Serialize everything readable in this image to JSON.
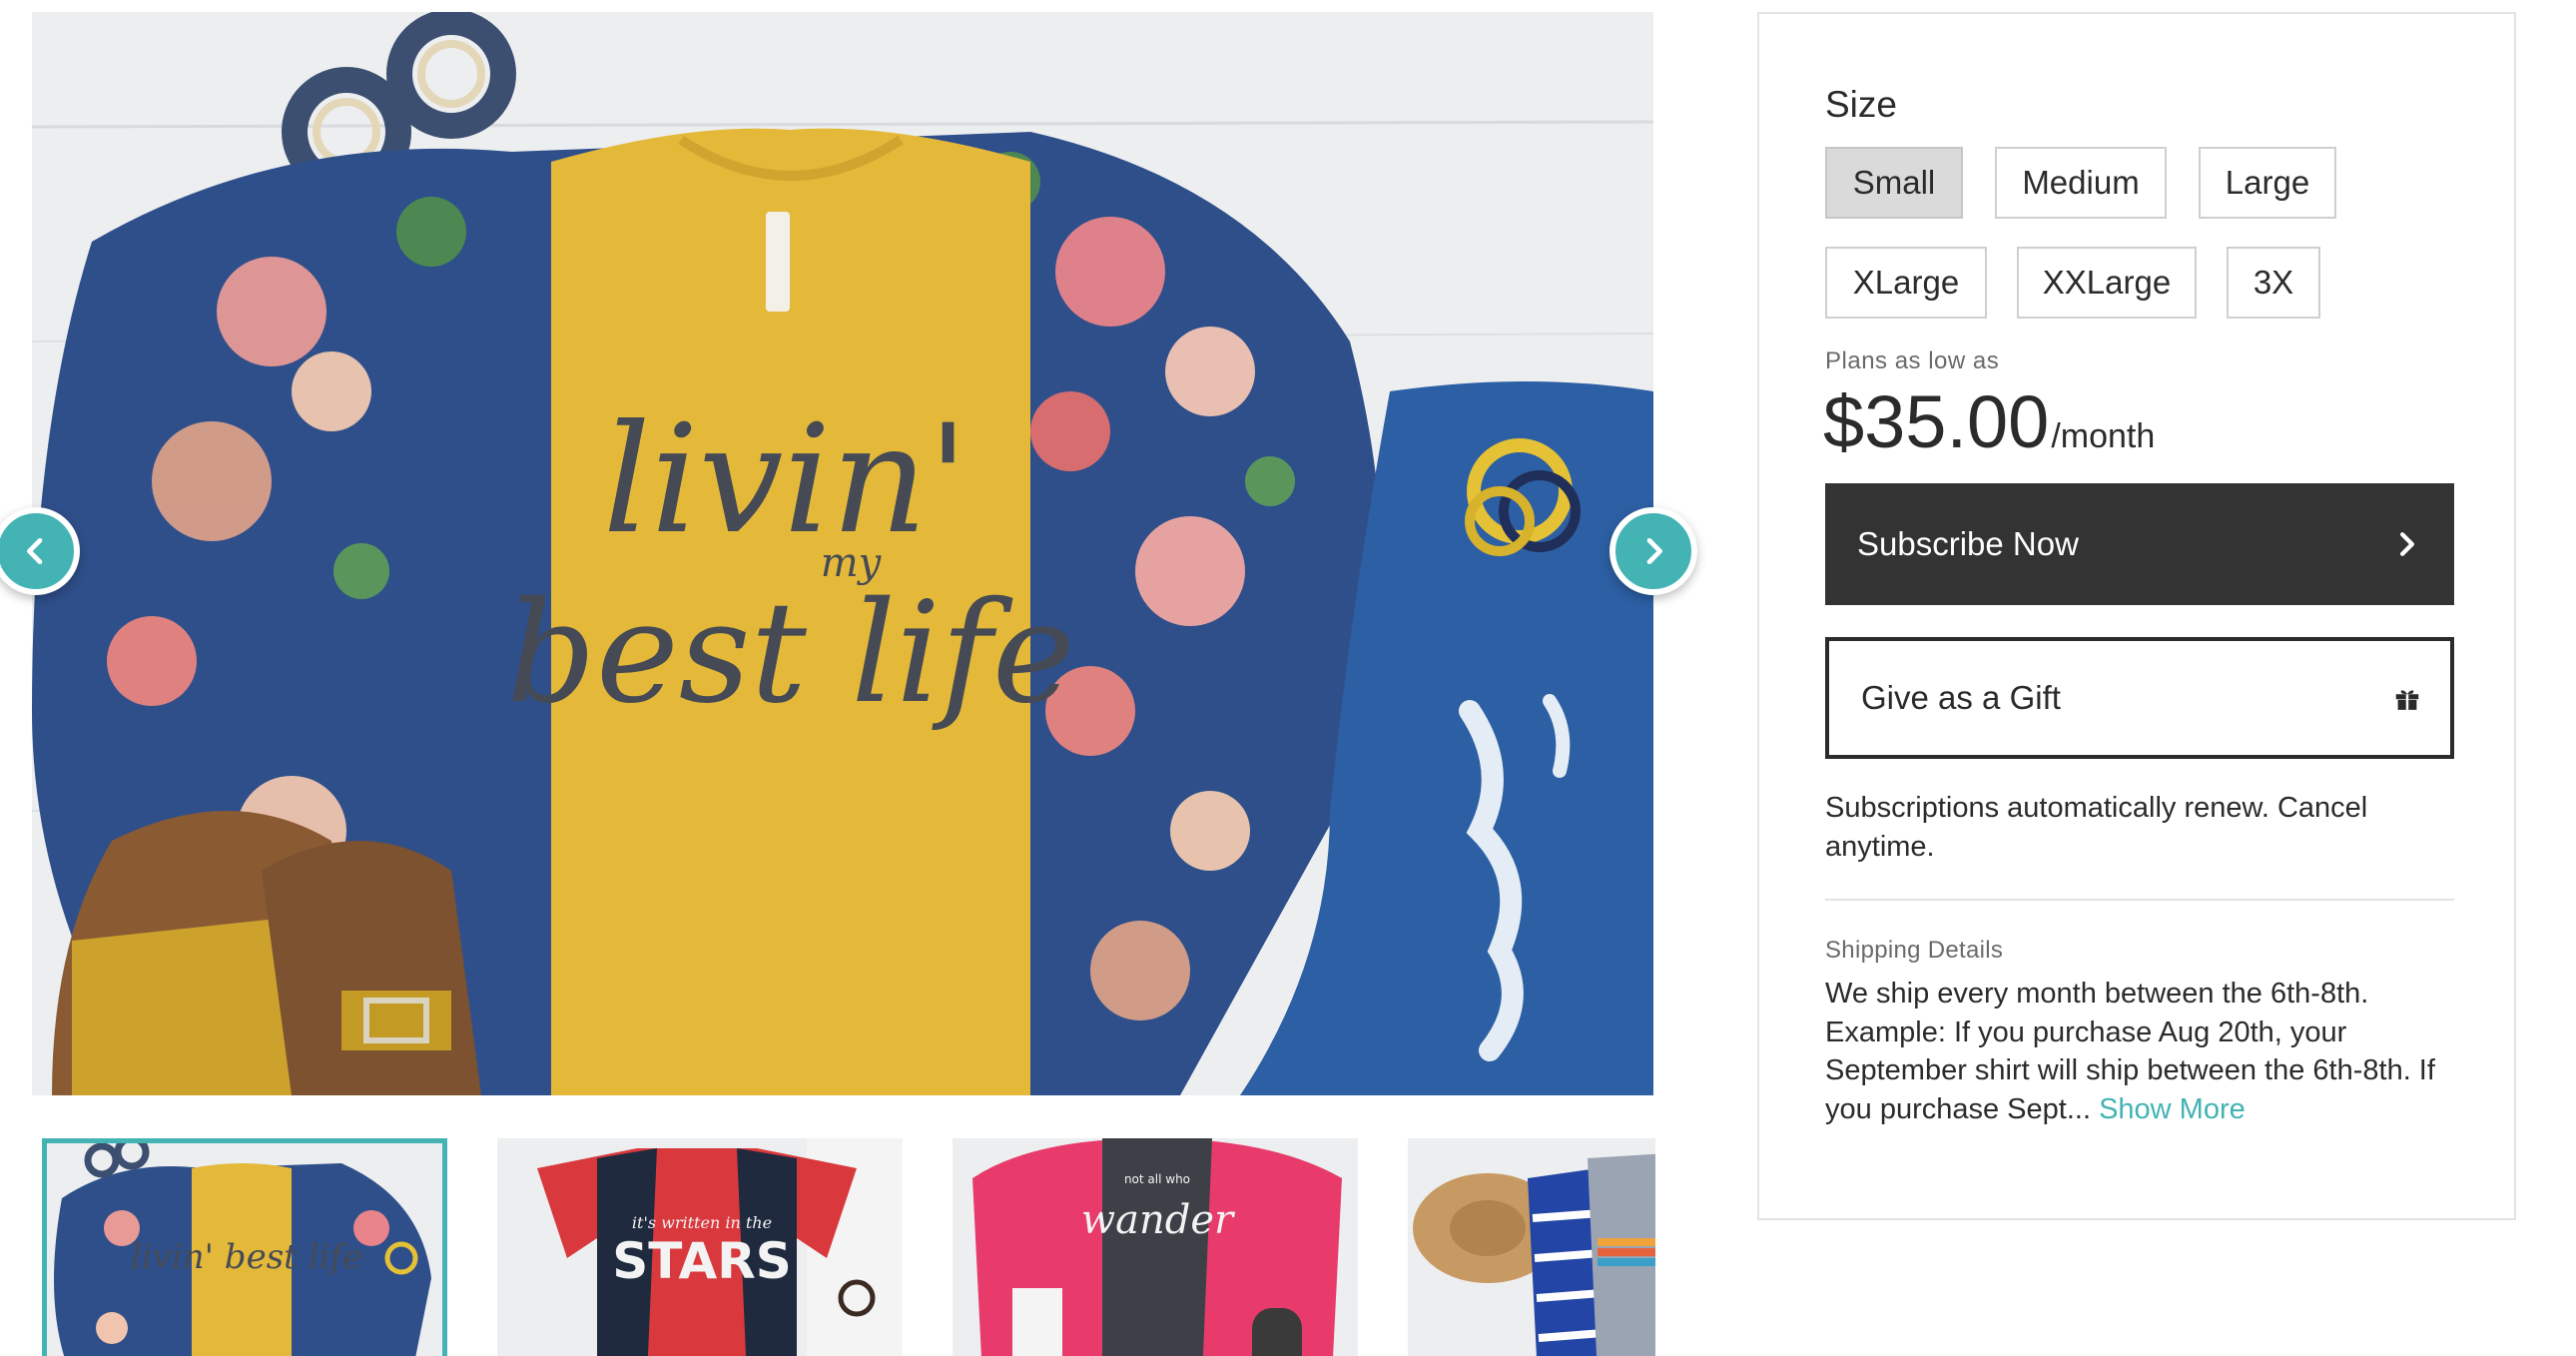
{
  "gallery": {
    "hero_print": {
      "line1": "livin'",
      "line2": "my",
      "line3": "best life"
    },
    "thumbnails": [
      {
        "print": "livin' best life",
        "active": true
      },
      {
        "print_small": "it's written in the",
        "print_big": "STARS",
        "active": false
      },
      {
        "print_small": "not all who",
        "print_big": "wander",
        "active": false
      },
      {
        "print_small": "",
        "print_big": "",
        "active": false
      }
    ]
  },
  "options": {
    "size_label": "Size",
    "sizes": [
      "Small",
      "Medium",
      "Large",
      "XLarge",
      "XXLarge",
      "3X"
    ],
    "selected": "Small"
  },
  "pricing": {
    "plans_label": "Plans as low as",
    "price": "$35.00",
    "period": "/month"
  },
  "actions": {
    "subscribe_label": "Subscribe Now",
    "gift_label": "Give as a Gift"
  },
  "renew_note": "Subscriptions automatically renew. Cancel anytime.",
  "shipping": {
    "title": "Shipping Details",
    "text": "We ship every month between the 6th-8th. Example: If you purchase Aug 20th, your September shirt will ship between the 6th-8th. If you purchase Sept... ",
    "show_more": "Show More"
  },
  "colors": {
    "accent": "#43b3b4",
    "dark_button": "#333333",
    "selected_size": "#dadada",
    "tee_yellow": "#e4b93a",
    "kimono_blue": "#2f4f8a"
  },
  "icons": {
    "prev": "chevron-left-icon",
    "next": "chevron-right-icon",
    "subscribe": "chevron-right-icon",
    "gift": "gift-icon"
  }
}
